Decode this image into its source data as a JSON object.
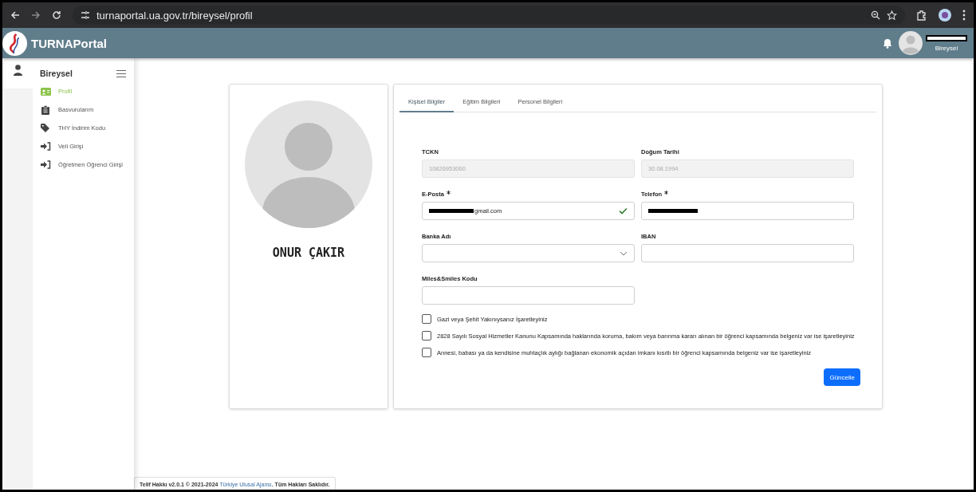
{
  "browser": {
    "url": "turnaportal.ua.gov.tr/bireysel/profil"
  },
  "header": {
    "brand": "TURNAPortal",
    "user_role": "Bireysel"
  },
  "sidebar": {
    "title": "Bireysel",
    "items": [
      {
        "label": "Profil",
        "selected": true
      },
      {
        "label": "Basvurularım",
        "selected": false
      },
      {
        "label": "THY İndirim Kodu",
        "selected": false
      },
      {
        "label": "Veli Girişi",
        "selected": false
      },
      {
        "label": "Öğretmen Öğrenci Girişi",
        "selected": false
      }
    ]
  },
  "profile": {
    "name": "ONUR ÇAKIR"
  },
  "tabs": [
    {
      "label": "Kişisel Bilgiler",
      "selected": true
    },
    {
      "label": "Eğitim Bilgileri",
      "selected": false
    },
    {
      "label": "Personel Bilgileri",
      "selected": false
    }
  ],
  "fields": [
    {
      "label": "TCKN",
      "kind": "text",
      "value": "10826953060",
      "disabled": true,
      "required": false
    },
    {
      "label": "Doğum Tarihi",
      "kind": "text",
      "value": "30.08.1994",
      "disabled": true,
      "required": false
    },
    {
      "label": "E-Posta",
      "kind": "text",
      "value": "gmail.com",
      "redacted": true,
      "valid": true,
      "disabled": false,
      "required": true
    },
    {
      "label": "Telefon",
      "kind": "text",
      "redacted": true,
      "disabled": false,
      "required": true
    },
    {
      "label": "Banka Adı",
      "kind": "select",
      "required": false
    },
    {
      "label": "IBAN",
      "kind": "text",
      "disabled": false,
      "required": false
    },
    {
      "label": "Miles&Smiles Kodu",
      "kind": "text",
      "disabled": false,
      "required": false
    }
  ],
  "checkboxes": [
    {
      "label": "Gazi veya Şehit Yakınıysanız İşaretleyiniz",
      "checked": false
    },
    {
      "label": "2828 Sayılı Sosyal Hizmetler Kanunu Kapsamında haklarında koruma, bakım veya barınma kararı alınan bir öğrenci kapsamında belgeniz var ise işaretleyiniz",
      "checked": false
    },
    {
      "label": "Annesi, babası ya da kendisine muhtaçlık aylığı bağlanan ekonomik açıdan imkanı kısıtlı bir öğrenci kapsamında belgeniz var ise işaretleyiniz",
      "checked": false
    }
  ],
  "submit": "Güncelle",
  "footer": {
    "text": "Telif Hakkı v2.0.1 © 2021-2024 ",
    "link": "Türkiye Ulusal Ajansı",
    "suffix": ". Tüm Hakları Saklıdır."
  }
}
